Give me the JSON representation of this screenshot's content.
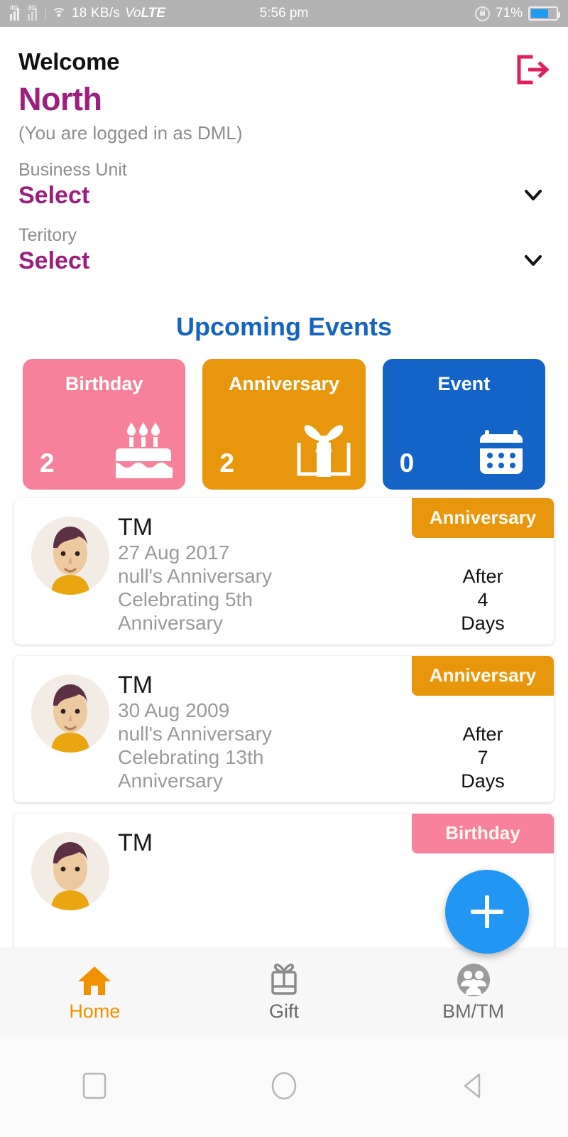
{
  "statusbar": {
    "net_4g": "4G",
    "net_3g": "3G",
    "speed": "18 KB/s",
    "volte_pre": "Vo",
    "volte_post": "LTE",
    "time": "5:56 pm",
    "battery_percent": "71%"
  },
  "header": {
    "welcome": "Welcome",
    "username": "North",
    "subtitle": "(You are logged in as DML)",
    "logout_icon": "logout-icon",
    "accent": "#9c1f7f",
    "logout_color": "#e01f5a"
  },
  "fields": [
    {
      "label": "Business Unit",
      "value": "Select",
      "icon": "chevron-down-icon"
    },
    {
      "label": "Teritory",
      "value": "Select",
      "icon": "chevron-down-icon"
    }
  ],
  "section": {
    "title": "Upcoming Events",
    "color": "#1464c0"
  },
  "stats": [
    {
      "label": "Birthday",
      "count": "2",
      "color": "#f7809a",
      "icon": "birthday-cake-icon"
    },
    {
      "label": "Anniversary",
      "count": "2",
      "color": "#e8960c",
      "icon": "gift-box-icon"
    },
    {
      "label": "Event",
      "count": "0",
      "color": "#1464c8",
      "icon": "calendar-icon"
    }
  ],
  "events": [
    {
      "name": "TM",
      "date": "27 Aug 2017",
      "line2": "null's Anniversary",
      "line3": "Celebrating 5th",
      "line4": "Anniversary",
      "badge": "Anniversary",
      "badge_color": "#e8960c",
      "after_label": "After",
      "after_count": "4",
      "after_unit": "Days"
    },
    {
      "name": "TM",
      "date": "30 Aug 2009",
      "line2": "null's Anniversary",
      "line3": "Celebrating 13th",
      "line4": "Anniversary",
      "badge": "Anniversary",
      "badge_color": "#e8960c",
      "after_label": "After",
      "after_count": "7",
      "after_unit": "Days"
    },
    {
      "name": "TM",
      "date": "",
      "line2": "",
      "line3": "",
      "line4": "",
      "badge": "Birthday",
      "badge_color": "#f7809a",
      "after_label": "",
      "after_count": "",
      "after_unit": ""
    }
  ],
  "fab": {
    "icon": "plus-icon",
    "color": "#2196f3"
  },
  "bottom_nav": [
    {
      "label": "Home",
      "icon": "home-icon",
      "active": true
    },
    {
      "label": "Gift",
      "icon": "gift-icon",
      "active": false
    },
    {
      "label": "BM/TM",
      "icon": "people-icon",
      "active": false
    }
  ],
  "system_nav": [
    {
      "icon": "recents-square-icon"
    },
    {
      "icon": "home-circle-icon"
    },
    {
      "icon": "back-triangle-icon"
    }
  ]
}
